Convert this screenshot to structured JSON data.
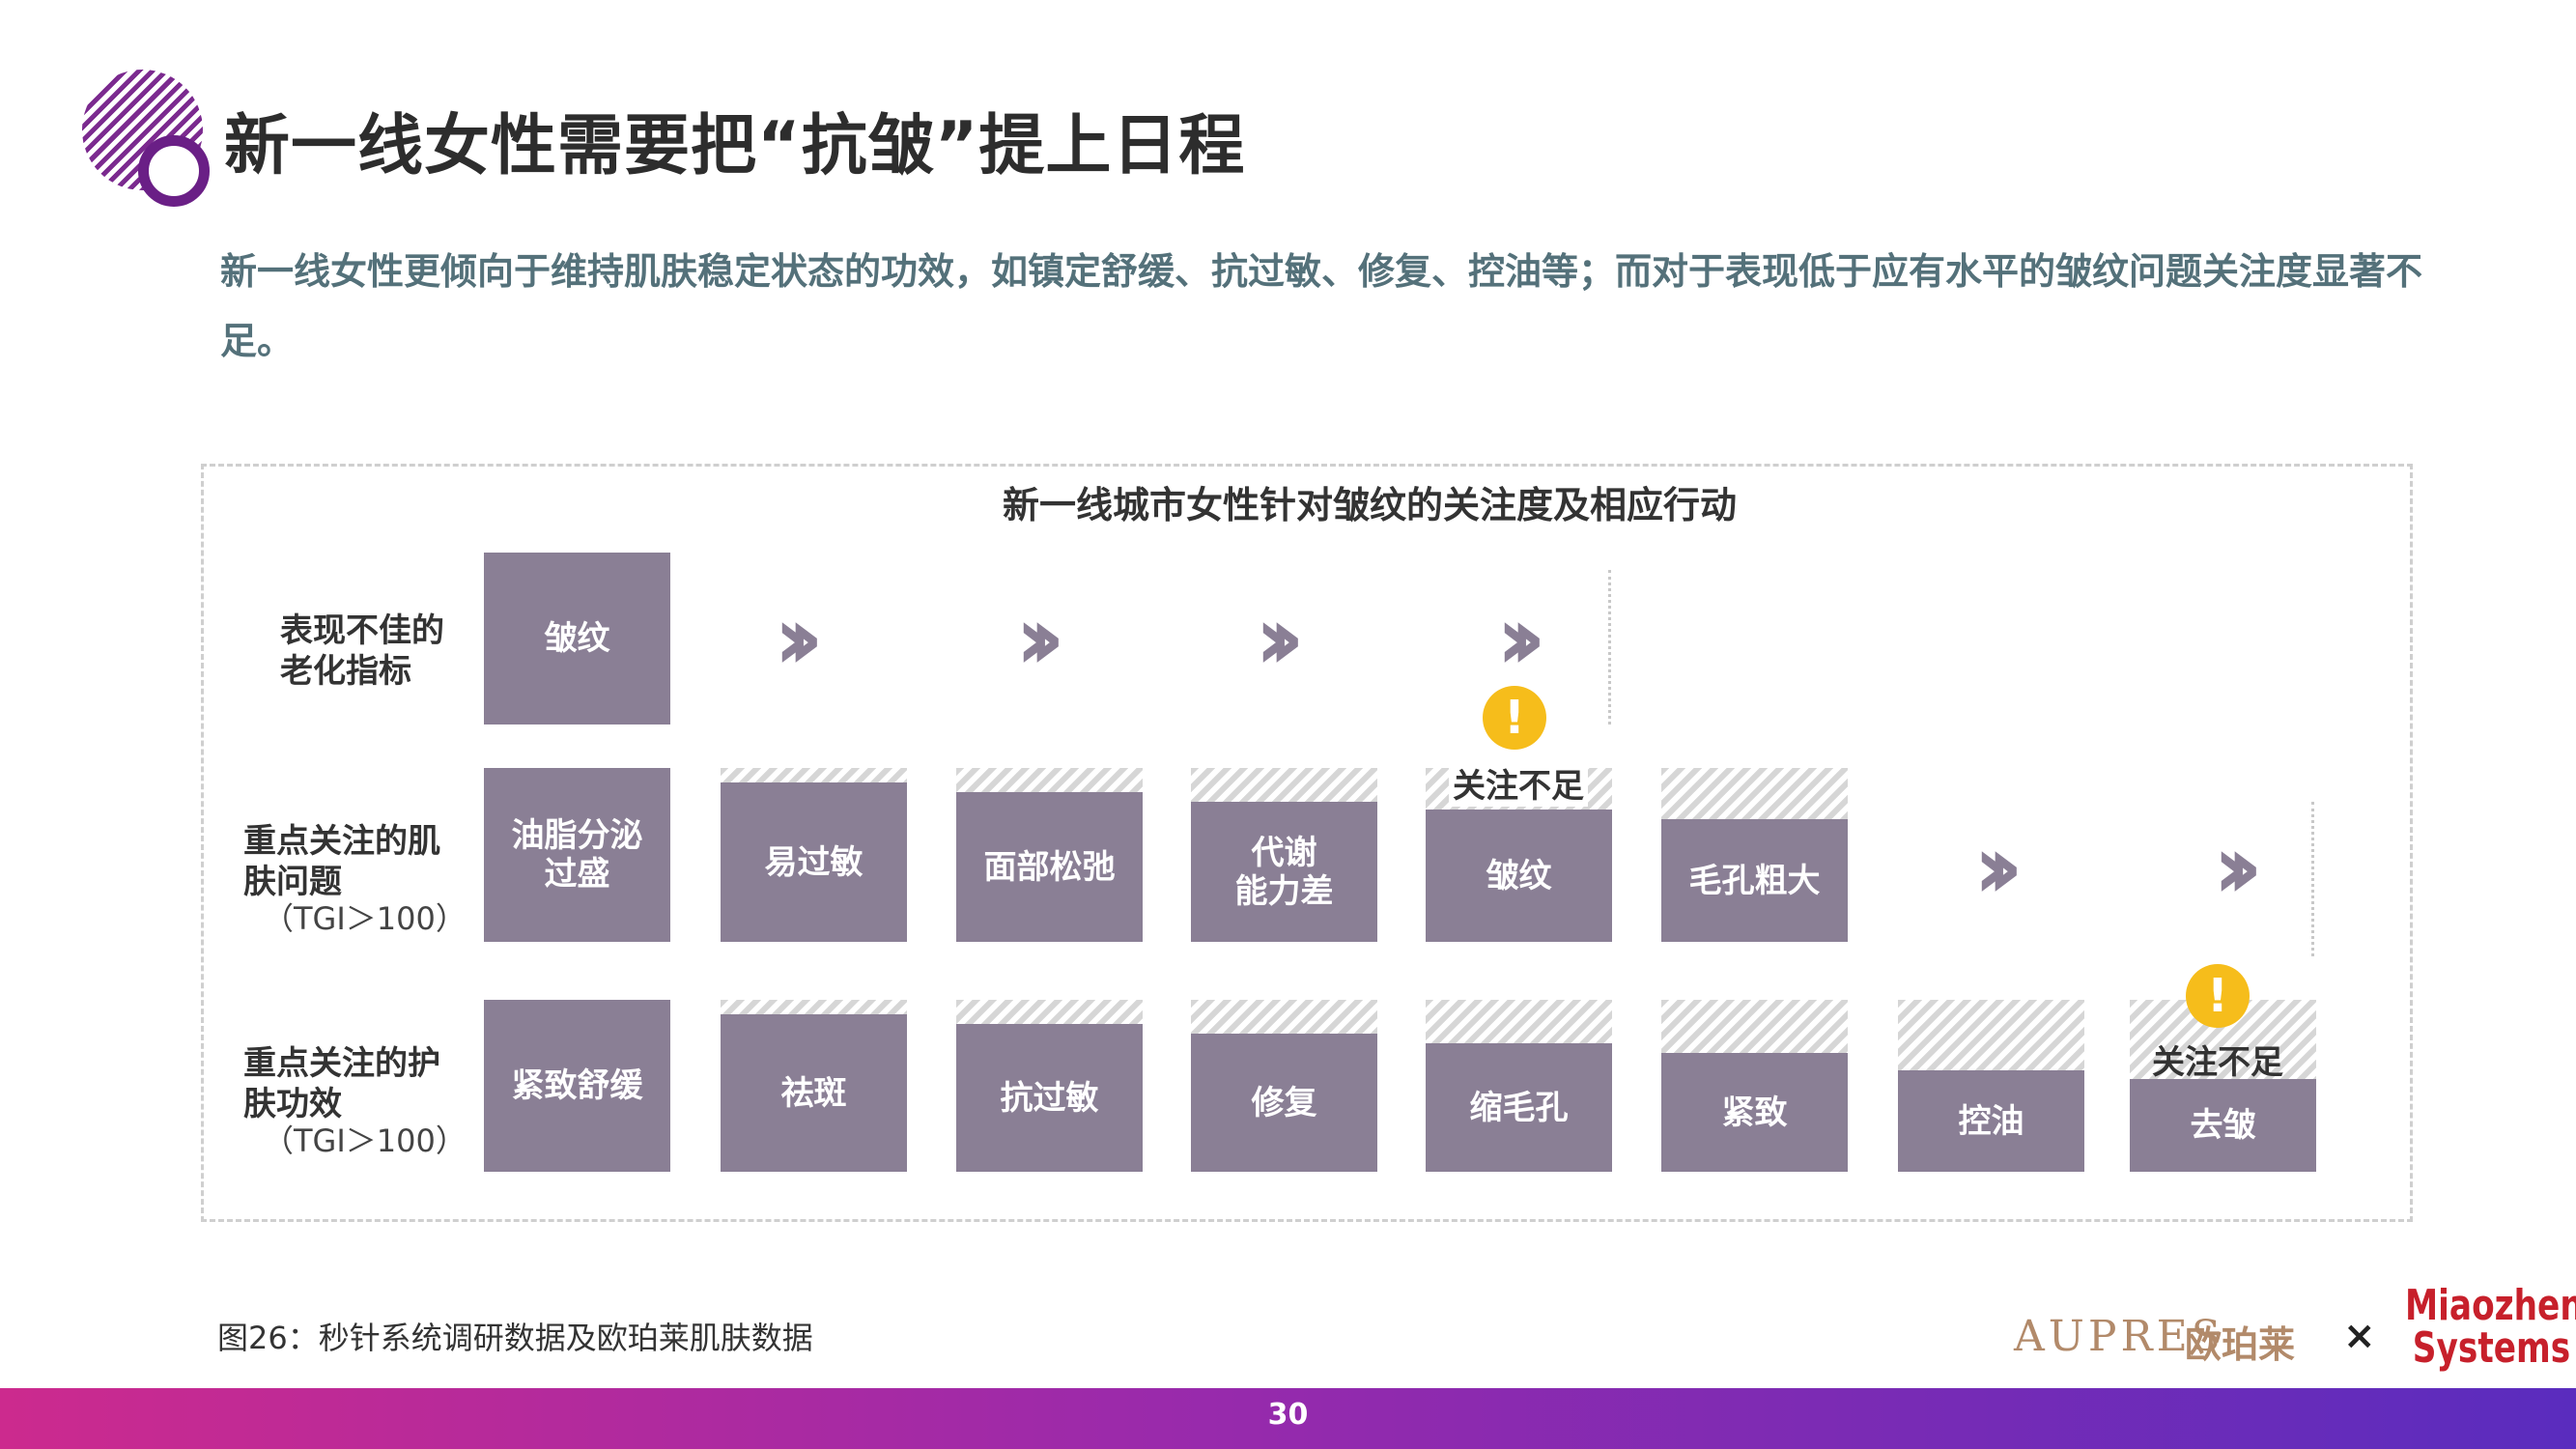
{
  "title": "新一线女性需要把“抗皱”提上日程",
  "subtitle": "新一线女性更倾向于维持肌肤稳定状态的功效，如镇定舒缓、抗过敏、修复、控油等；而对于表现低于应有水平的皱纹问题关注度显著不足。",
  "chart": {
    "title": "新一线城市女性针对皱纹的关注度及相应行动",
    "rows": {
      "indicator": "表现不佳的\n老化指标",
      "skin_issues": "重点关注的肌\n肤问题",
      "skin_issues_tgi": "（TGI＞100）",
      "care_effects": "重点关注的护\n肤功效",
      "care_effects_tgi": "（TGI＞100）"
    },
    "indicator_box": "皱纹",
    "skin_issues": [
      "油脂分泌\n过盛",
      "易过敏",
      "面部松弛",
      "代谢\n能力差",
      "皱纹",
      "毛孔粗大"
    ],
    "care_effects": [
      "紧致舒缓",
      "祛斑",
      "抗过敏",
      "修复",
      "缩毛孔",
      "紧致",
      "控油",
      "去皱"
    ],
    "warning_label": "关注不足",
    "warning_icon": "exclamation-icon",
    "chevron_icon": "double-chevron-right-icon",
    "box_color": "#8a7f95",
    "warning_color": "#f6bd1b"
  },
  "caption": "图26：秒针系统调研数据及欧珀莱肌肤数据",
  "brand": {
    "aupres_latin": "AUPRES",
    "aupres_cn": "欧珀莱",
    "times": "×",
    "miaozhen_line1": "Miaozhen",
    "miaozhen_line2": "Systems"
  },
  "page_number": "30"
}
